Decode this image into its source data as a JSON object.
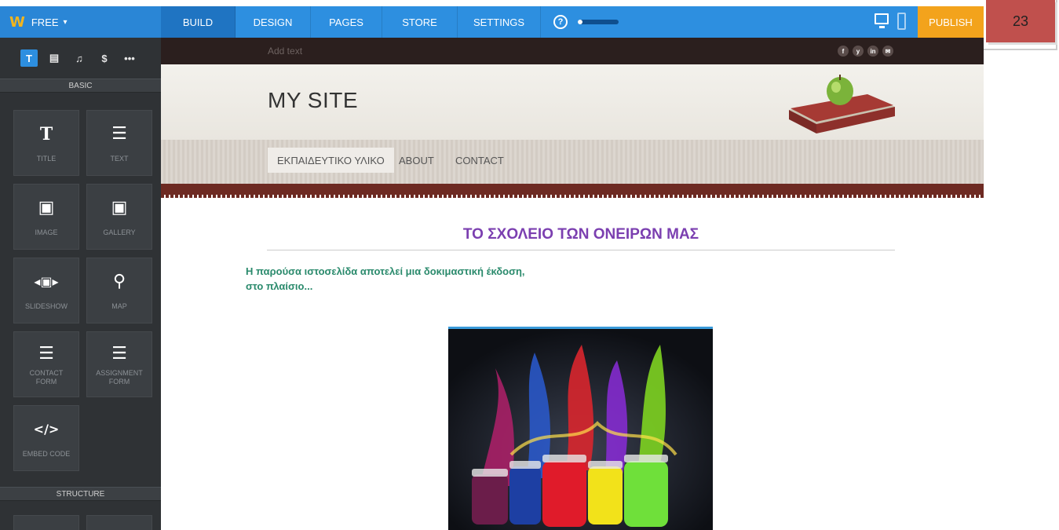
{
  "toolbar": {
    "brand": "FREE",
    "tabs": [
      "BUILD",
      "DESIGN",
      "PAGES",
      "STORE",
      "SETTINGS"
    ],
    "help": "?",
    "progress_fraction": 0.12,
    "publish": "PUBLISH"
  },
  "page_number": "23",
  "sidebar": {
    "section_basic": "BASIC",
    "section_structure": "STRUCTURE",
    "tools": [
      "T",
      "▤",
      "♫",
      "$",
      "•••"
    ],
    "elements": [
      {
        "icon": "T",
        "label": "TITLE"
      },
      {
        "icon": "☰",
        "label": "TEXT"
      },
      {
        "icon": "▣",
        "label": "IMAGE"
      },
      {
        "icon": "▣",
        "label": "GALLERY"
      },
      {
        "icon": "◂▣▸",
        "label": "SLIDESHOW"
      },
      {
        "icon": "⚲",
        "label": "MAP"
      },
      {
        "icon": "☰",
        "label": "CONTACT FORM"
      },
      {
        "icon": "☰",
        "label": "ASSIGNMENT FORM"
      },
      {
        "icon": "</>",
        "label": "EMBED CODE"
      }
    ]
  },
  "site": {
    "add_text": "Add text",
    "social": [
      "f",
      "y",
      "in",
      "✉"
    ],
    "title": "MY SITE",
    "menu": [
      "ΕΚΠΑΙΔΕΥΤΙΚΟ ΥΛΙΚΟ",
      "ABOUT",
      "CONTACT"
    ],
    "heading": "ΤΟ ΣΧΟΛΕΙΟ ΤΩΝ ΟΝΕΙΡΩΝ ΜΑΣ",
    "intro_line1": "Η παρούσα ιστοσελίδα αποτελεί μια δοκιμαστική έκδοση,",
    "intro_line2": "στο πλαίσιο..."
  }
}
